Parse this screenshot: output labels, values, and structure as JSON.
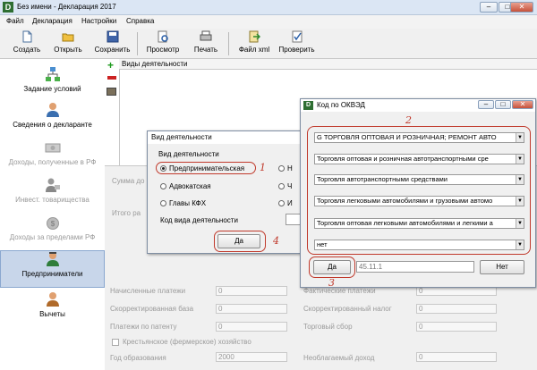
{
  "window": {
    "title": "Без имени - Декларация 2017",
    "controls": [
      "–",
      "□",
      "✕"
    ]
  },
  "menu": [
    "Файл",
    "Декларация",
    "Настройки",
    "Справка"
  ],
  "toolbar": [
    {
      "label": "Создать",
      "icon": "new-document-icon"
    },
    {
      "label": "Открыть",
      "icon": "open-folder-icon"
    },
    {
      "label": "Сохранить",
      "icon": "save-icon"
    },
    {
      "label": "Просмотр",
      "icon": "preview-icon"
    },
    {
      "label": "Печать",
      "icon": "print-icon"
    },
    {
      "label": "Файл xml",
      "icon": "xml-file-icon"
    },
    {
      "label": "Проверить",
      "icon": "check-icon"
    }
  ],
  "sidebar": [
    {
      "label": "Задание условий",
      "state": "normal"
    },
    {
      "label": "Сведения о декларанте",
      "state": "normal"
    },
    {
      "label": "Доходы, полученные в РФ",
      "state": "disabled"
    },
    {
      "label": "Инвест. товарищества",
      "state": "disabled"
    },
    {
      "label": "Доходы за пределами РФ",
      "state": "disabled"
    },
    {
      "label": "Предприниматели",
      "state": "selected"
    },
    {
      "label": "Вычеты",
      "state": "normal"
    }
  ],
  "main": {
    "column_header": "Виды деятельности"
  },
  "background_form": {
    "label_sum": "Сумма до",
    "label_total": "Итого ра",
    "fields": [
      {
        "label": "Начисленные платежи",
        "value": "0"
      },
      {
        "label": "Скорректированная база",
        "value": "0"
      },
      {
        "label": "Платежи по патенту",
        "value": "0"
      },
      {
        "label": "Фактические платежи",
        "value": "0"
      },
      {
        "label": "Скорректированный налог",
        "value": "0"
      },
      {
        "label": "Торговый сбор",
        "value": "0"
      }
    ],
    "checkbox_label": "Крестьянское (фермерское) хозяйство",
    "year_label": "Год образования",
    "year_value": "2000",
    "unneeded_label": "Необлагаемый доход",
    "unneeded_value": "0"
  },
  "dialog_activity": {
    "title": "Вид деятельности",
    "group_label": "Вид деятельности",
    "options": [
      {
        "label": "Предпринимательская",
        "selected": true
      },
      {
        "label": "Адвокатская",
        "selected": false
      },
      {
        "label": "Главы КФХ",
        "selected": false
      },
      {
        "label": "Н",
        "selected": false
      },
      {
        "label": "Ч",
        "selected": false
      },
      {
        "label": "И",
        "selected": false
      }
    ],
    "code_label": "Код вида деятельности",
    "ok_label": "Да",
    "annotation_1": "1",
    "annotation_4": "4"
  },
  "dialog_okved": {
    "title": "Код по ОКВЭД",
    "combos": [
      "G ТОРГОВЛЯ ОПТОВАЯ И РОЗНИЧНАЯ; РЕМОНТ АВТО",
      "Торговля оптовая и розничная автотранспортными сре",
      "Торговля автотранспортными средствами",
      "Торговля легковыми автомобилями и грузовыми автомо",
      "Торговля оптовая легковыми автомобилями и легкими а",
      "нет"
    ],
    "ok_label": "Да",
    "code_value": "45.11.1",
    "cancel_label": "Нет",
    "annotation_2": "2",
    "annotation_3": "3"
  }
}
